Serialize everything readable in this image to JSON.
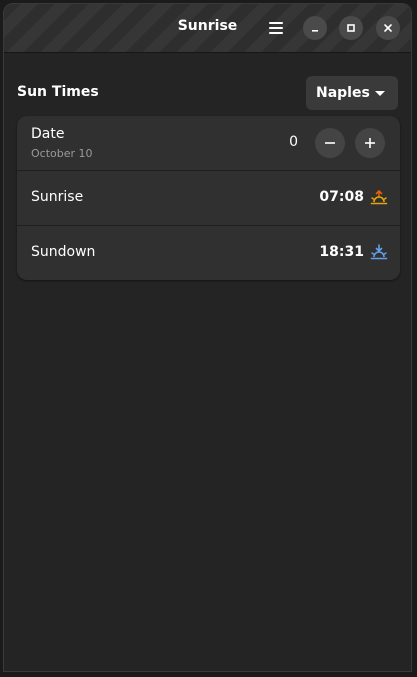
{
  "window": {
    "title": "Sunrise"
  },
  "header": {
    "section_title": "Sun Times",
    "location": "Naples"
  },
  "date_row": {
    "title": "Date",
    "subtitle": "October 10",
    "offset": "0"
  },
  "rows": [
    {
      "label": "Sunrise",
      "time": "07:08",
      "icon": "sunrise-icon",
      "icon_color": "#e5a50a"
    },
    {
      "label": "Sundown",
      "time": "18:31",
      "icon": "sunset-icon",
      "icon_color": "#62a0ea"
    }
  ],
  "colors": {
    "sunrise_accent": "#e5a50a",
    "sunrise_secondary": "#e66100",
    "sunset_accent": "#62a0ea"
  }
}
